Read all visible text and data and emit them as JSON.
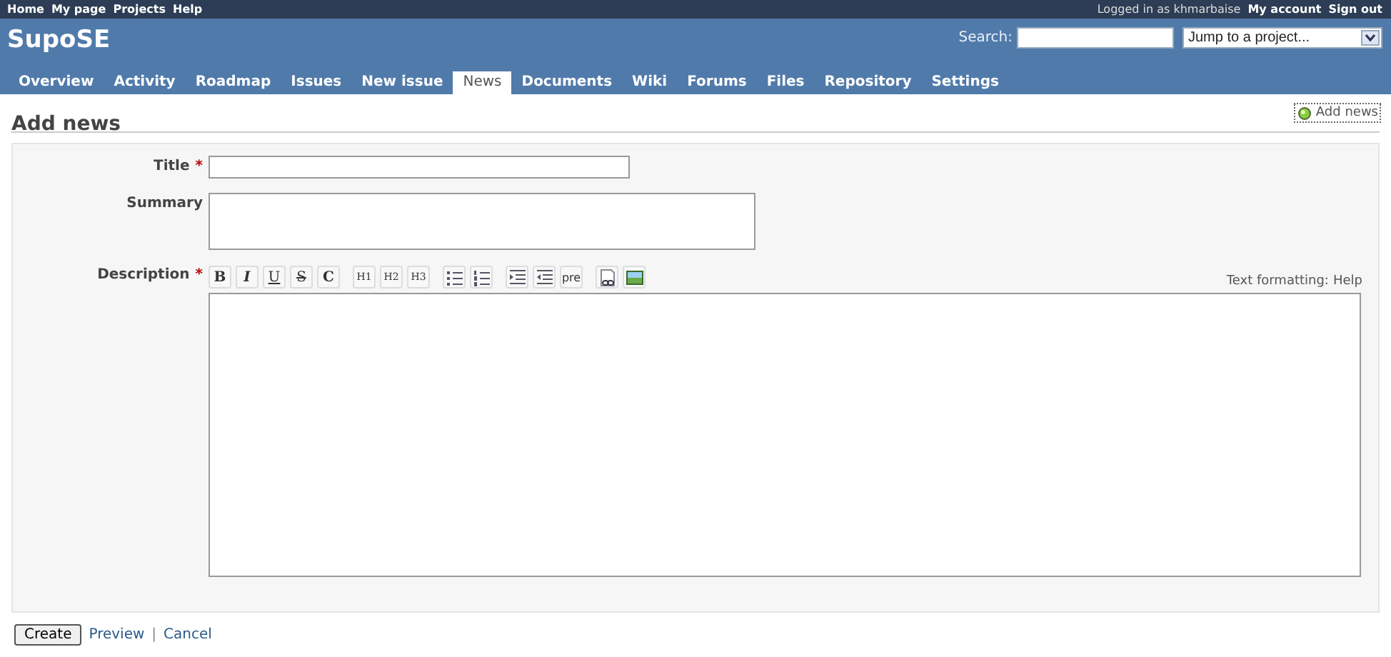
{
  "top_menu": {
    "links": [
      "Home",
      "My page",
      "Projects",
      "Help"
    ],
    "logged_in": "Logged in as khmarbaise",
    "account_links": [
      "My account",
      "Sign out"
    ]
  },
  "header": {
    "title": "SupoSE",
    "search_label": "Search:",
    "project_jump": "Jump to a project..."
  },
  "tabs": [
    {
      "label": "Overview",
      "selected": false
    },
    {
      "label": "Activity",
      "selected": false
    },
    {
      "label": "Roadmap",
      "selected": false
    },
    {
      "label": "Issues",
      "selected": false
    },
    {
      "label": "New issue",
      "selected": false
    },
    {
      "label": "News",
      "selected": true
    },
    {
      "label": "Documents",
      "selected": false
    },
    {
      "label": "Wiki",
      "selected": false
    },
    {
      "label": "Forums",
      "selected": false
    },
    {
      "label": "Files",
      "selected": false
    },
    {
      "label": "Repository",
      "selected": false
    },
    {
      "label": "Settings",
      "selected": false
    }
  ],
  "page": {
    "heading": "Add news",
    "action_link": "Add news"
  },
  "form": {
    "fields": [
      {
        "label": "Title",
        "required_mark": "*",
        "kind": "line"
      },
      {
        "label": "Summary",
        "kind": "area"
      },
      {
        "label": "Description",
        "required_mark": "*",
        "kind": "editor"
      }
    ],
    "toolbar": [
      {
        "kind": "text",
        "label": "B"
      },
      {
        "kind": "text",
        "label": "I"
      },
      {
        "kind": "text",
        "label": "U"
      },
      {
        "kind": "text",
        "label": "S"
      },
      {
        "kind": "text",
        "label": "C"
      },
      {
        "kind": "text",
        "label": "H1"
      },
      {
        "kind": "text",
        "label": "H2"
      },
      {
        "kind": "text",
        "label": "H3"
      },
      {
        "kind": "bullets"
      },
      {
        "kind": "numbers"
      },
      {
        "kind": "indent"
      },
      {
        "kind": "outdent"
      },
      {
        "kind": "text",
        "label": "pre"
      },
      {
        "kind": "link"
      },
      {
        "kind": "image"
      }
    ],
    "formatting_label": "Text formatting:",
    "formatting_help": "Help"
  },
  "footer": {
    "submit": "Create",
    "links": [
      "Preview",
      "Cancel"
    ],
    "separator": "|"
  }
}
